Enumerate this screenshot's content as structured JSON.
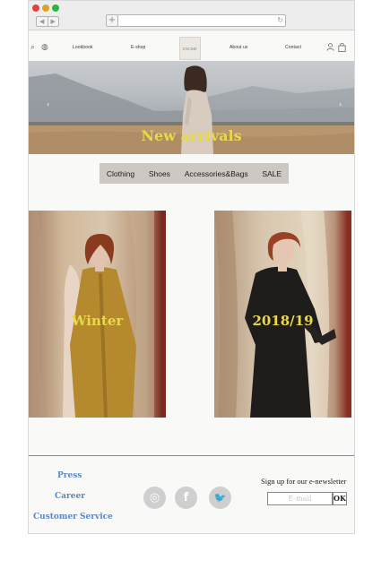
{
  "browser": {
    "back": "◀",
    "forward": "▶",
    "new_tab": "+",
    "reload": "↻"
  },
  "topnav": {
    "icons": {
      "search": "search-icon",
      "globe": "globe-icon",
      "account": "user-icon",
      "bag": "shopping-bag-icon"
    },
    "links": [
      "Lookbook",
      "E-shop",
      "About us",
      "Contact"
    ],
    "logo_text": "ENCIHE"
  },
  "hero": {
    "title": "New arrivals",
    "prev_arrow": "‹",
    "next_arrow": "›"
  },
  "categories": [
    "Clothing",
    "Shoes",
    "Accessories&Bags",
    "SALE"
  ],
  "cards": [
    {
      "title": "Winter"
    },
    {
      "title": "2018/19"
    }
  ],
  "footer": {
    "links": [
      "Press",
      "Career",
      "Customer Service"
    ],
    "social": [
      {
        "icon": "instagram-icon",
        "glyph": "◎"
      },
      {
        "icon": "facebook-icon",
        "glyph": "f"
      },
      {
        "icon": "twitter-icon",
        "glyph": "🐦"
      }
    ],
    "newsletter_label": "Sign up for our e-newsletter",
    "email_placeholder": "E-mail",
    "ok_label": "OK"
  },
  "colors": {
    "accent_yellow": "#e8d84a",
    "footer_link_blue": "#5b87c4",
    "category_bar": "#cdc8c4"
  }
}
